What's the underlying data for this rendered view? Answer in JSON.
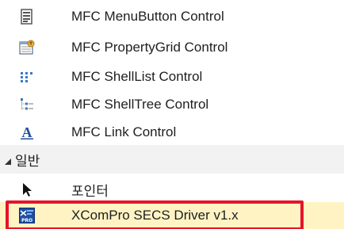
{
  "items": [
    {
      "label": "MFC MenuButton Control",
      "icon": "menubutton-icon"
    },
    {
      "label": "MFC PropertyGrid Control",
      "icon": "propertygrid-icon"
    },
    {
      "label": "MFC ShellList Control",
      "icon": "shelllist-icon"
    },
    {
      "label": "MFC ShellTree Control",
      "icon": "shelltree-icon"
    },
    {
      "label": "MFC Link Control",
      "icon": "link-icon"
    }
  ],
  "group": {
    "label": "일반",
    "expanded": true,
    "items": [
      {
        "label": "포인터",
        "icon": "pointer-icon"
      },
      {
        "label": "XComPro SECS Driver v1.x",
        "icon": "xcompro-icon",
        "selected": true
      }
    ]
  },
  "colors": {
    "selection_background": "#fff3c4",
    "highlight_frame": "#e5142b",
    "group_background": "#f2f2f2",
    "link_icon": "#1f4e9a"
  }
}
